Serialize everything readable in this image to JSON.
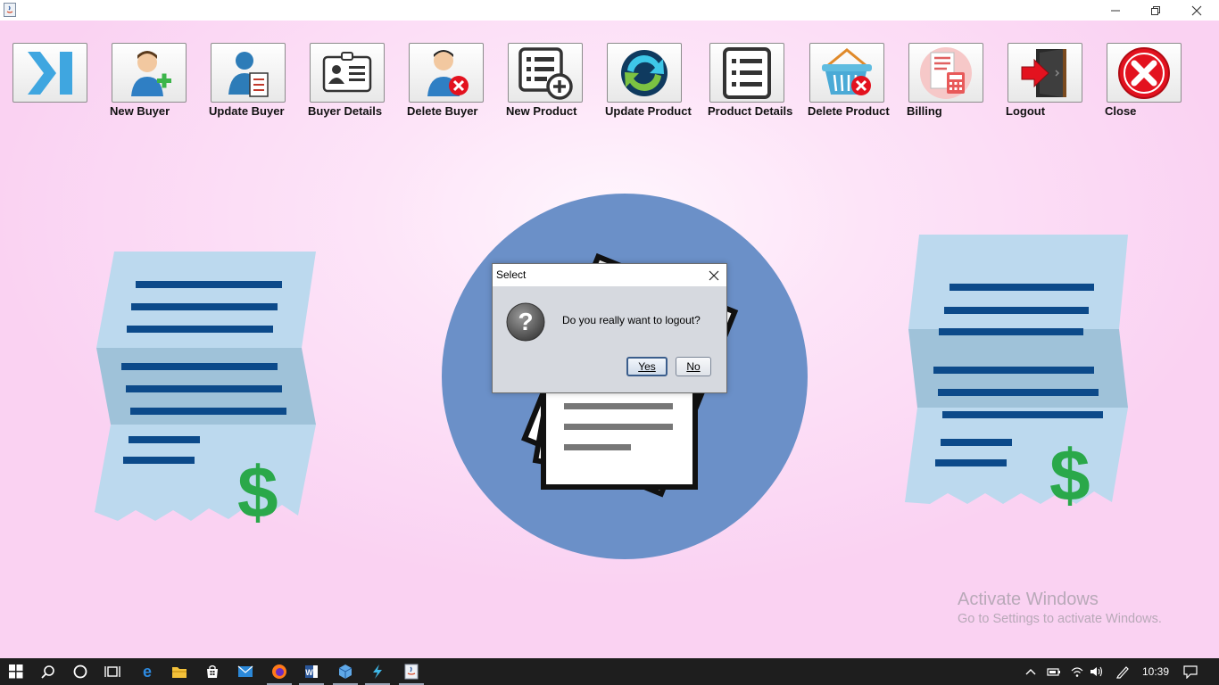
{
  "window": {
    "title": ""
  },
  "toolbar": {
    "buttons": [
      {
        "label": "",
        "icon": "skip-to-end-icon"
      },
      {
        "label": "New Buyer",
        "icon": "add-user-icon"
      },
      {
        "label": "Update Buyer",
        "icon": "edit-user-icon"
      },
      {
        "label": "Buyer Details",
        "icon": "id-card-icon"
      },
      {
        "label": "Delete Buyer",
        "icon": "delete-user-icon"
      },
      {
        "label": "New Product",
        "icon": "add-list-icon"
      },
      {
        "label": "Update Product",
        "icon": "refresh-icon"
      },
      {
        "label": "Product Details",
        "icon": "list-icon"
      },
      {
        "label": "Delete Product",
        "icon": "delete-basket-icon"
      },
      {
        "label": "Billing",
        "icon": "bill-calculator-icon"
      },
      {
        "label": "Logout",
        "icon": "logout-door-icon"
      },
      {
        "label": "Close",
        "icon": "close-circle-icon"
      }
    ]
  },
  "dialog": {
    "title": "Select",
    "message": "Do you really want to logout?",
    "yes_label": "Yes",
    "no_label": "No",
    "icon": "question-icon"
  },
  "watermark": {
    "line1": "Activate Windows",
    "line2": "Go to Settings to activate Windows."
  },
  "taskbar": {
    "clock": "10:39",
    "items": [
      "windows-start-icon",
      "search-icon",
      "cortana-icon",
      "task-view-icon",
      "edge-icon",
      "file-explorer-icon",
      "store-icon",
      "mail-icon",
      "firefox-icon",
      "word-icon",
      "cube-app-icon",
      "bolt-app-icon",
      "java-app-icon"
    ]
  },
  "colors": {
    "background": "#fcd9f5",
    "circle": "#6b90c8",
    "receipt": "#bcd9ee",
    "receipt_lines": "#0c4a8a",
    "dollar": "#2aa84a",
    "close_red": "#e3121f"
  }
}
